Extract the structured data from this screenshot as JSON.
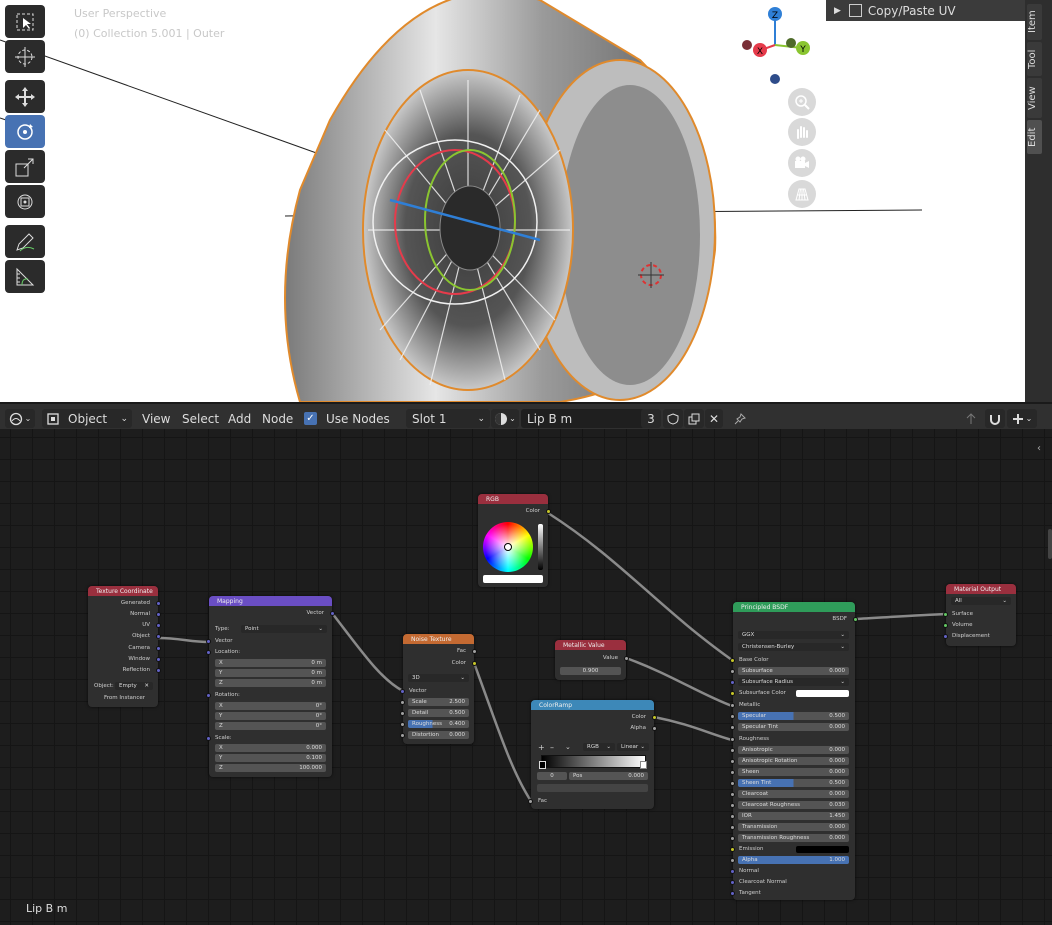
{
  "viewport": {
    "info_line1": "User Perspective",
    "info_line2": "(0) Collection 5.001 | Outer",
    "sidebar_panel_title": "Copy/Paste UV",
    "side_tabs": [
      "Item",
      "Tool",
      "View",
      "Edit"
    ],
    "active_side_tab": "Edit",
    "gizmo_axes": {
      "x": "X",
      "y": "Y",
      "z": "Z"
    },
    "axis_colors": {
      "x": "#e53b4b",
      "y": "#8ac530",
      "z": "#2f7fd6"
    }
  },
  "header": {
    "editor_icon": "node-editor-icon",
    "object_mode": "Object",
    "menus": [
      "View",
      "Select",
      "Add",
      "Node"
    ],
    "use_nodes_label": "Use Nodes",
    "use_nodes_checked": true,
    "slot": "Slot 1",
    "material_name": "Lip B m",
    "user_count": "3"
  },
  "nodes": {
    "texcoord": {
      "title": "Texture Coordinate",
      "outputs": [
        "Generated",
        "Normal",
        "UV",
        "Object",
        "Camera",
        "Window",
        "Reflection"
      ],
      "object_label": "Object:",
      "object_value": "Empty",
      "from_instancer": "From Instancer"
    },
    "mapping": {
      "title": "Mapping",
      "output": "Vector",
      "type_label": "Type:",
      "type_value": "Point",
      "vector_label": "Vector",
      "location_label": "Location:",
      "location": {
        "x": "0 m",
        "y": "0 m",
        "z": "0 m"
      },
      "rotation_label": "Rotation:",
      "rotation": {
        "x": "0°",
        "y": "0°",
        "z": "0°"
      },
      "scale_label": "Scale:",
      "scale": {
        "x": "0.000",
        "y": "0.100",
        "z": "100.000"
      }
    },
    "rgb": {
      "title": "RGB",
      "output": "Color"
    },
    "noise": {
      "title": "Noise Texture",
      "outputs": [
        "Fac",
        "Color"
      ],
      "dims": "3D",
      "vector_label": "Vector",
      "scale_label": "Scale",
      "scale": "2.500",
      "detail_label": "Detail",
      "detail": "0.500",
      "roughness_label": "Roughness",
      "roughness": "0.400",
      "distortion_label": "Distortion",
      "distortion": "0.000"
    },
    "metallic": {
      "title": "Metallic Value",
      "output": "Value",
      "value": "0.900"
    },
    "colorramp": {
      "title": "ColorRamp",
      "outputs": [
        "Color",
        "Alpha"
      ],
      "plus": "+",
      "minus": "–",
      "mode": "RGB",
      "interp": "Linear",
      "index": "0",
      "pos_label": "Pos",
      "pos": "0.000",
      "input": "Fac"
    },
    "principled": {
      "title": "Principled BSDF",
      "output": "BSDF",
      "distribution": "GGX",
      "subsurface_method": "Christensen-Burley",
      "base_color": "Base Color",
      "subsurface": "Subsurface",
      "subsurface_val": "0.000",
      "subsurface_radius": "Subsurface Radius",
      "subsurface_color": "Subsurface Color",
      "metallic": "Metallic",
      "specular": "Specular",
      "specular_val": "0.500",
      "specular_tint": "Specular Tint",
      "specular_tint_val": "0.000",
      "roughness": "Roughness",
      "anisotropic": "Anisotropic",
      "anisotropic_val": "0.000",
      "anisotropic_rotation": "Anisotropic Rotation",
      "anisotropic_rotation_val": "0.000",
      "sheen": "Sheen",
      "sheen_val": "0.000",
      "sheen_tint": "Sheen Tint",
      "sheen_tint_val": "0.500",
      "clearcoat": "Clearcoat",
      "clearcoat_val": "0.000",
      "clearcoat_roughness": "Clearcoat Roughness",
      "clearcoat_roughness_val": "0.030",
      "ior": "IOR",
      "ior_val": "1.450",
      "transmission": "Transmission",
      "transmission_val": "0.000",
      "transmission_roughness": "Transmission Roughness",
      "transmission_roughness_val": "0.000",
      "emission": "Emission",
      "alpha": "Alpha",
      "alpha_val": "1.000",
      "normal": "Normal",
      "clearcoat_normal": "Clearcoat Normal",
      "tangent": "Tangent",
      "specular_fraction": 0.5,
      "sheen_tint_fraction": 0.5,
      "alpha_fraction": 1.0
    },
    "output": {
      "title": "Material Output",
      "target": "All",
      "inputs": [
        "Surface",
        "Volume",
        "Displacement"
      ]
    }
  },
  "footer": {
    "material_label": "Lip B m"
  }
}
